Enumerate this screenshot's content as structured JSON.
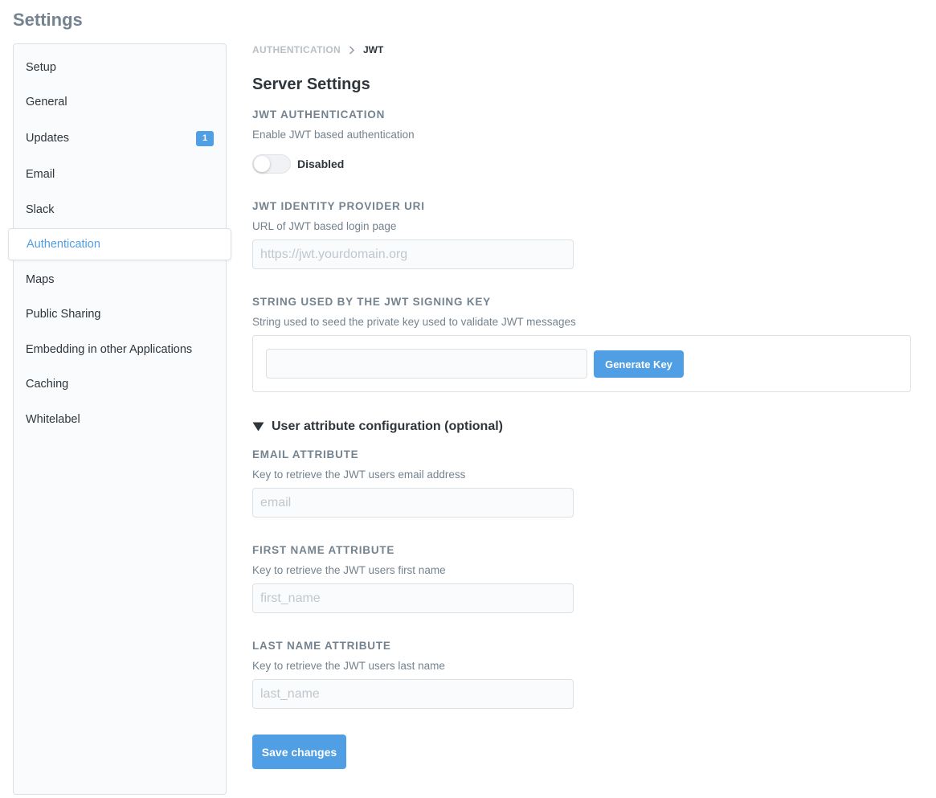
{
  "page": {
    "title": "Settings"
  },
  "sidebar": {
    "items": [
      {
        "label": "Setup"
      },
      {
        "label": "General"
      },
      {
        "label": "Updates",
        "badge": "1"
      },
      {
        "label": "Email"
      },
      {
        "label": "Slack"
      },
      {
        "label": "Authentication",
        "active": true
      },
      {
        "label": "Maps"
      },
      {
        "label": "Public Sharing"
      },
      {
        "label": "Embedding in other Applications"
      },
      {
        "label": "Caching"
      },
      {
        "label": "Whitelabel"
      }
    ]
  },
  "breadcrumb": {
    "parent": "AUTHENTICATION",
    "current": "JWT"
  },
  "main": {
    "section_title": "Server Settings",
    "jwt_auth": {
      "label": "JWT AUTHENTICATION",
      "description": "Enable JWT based authentication",
      "toggle_state": "Disabled",
      "enabled": false
    },
    "identity_provider": {
      "label": "JWT IDENTITY PROVIDER URI",
      "description": "URL of JWT based login page",
      "placeholder": "https://jwt.yourdomain.org",
      "value": ""
    },
    "signing_key": {
      "label": "STRING USED BY THE JWT SIGNING KEY",
      "description": "String used to seed the private key used to validate JWT messages",
      "value": "",
      "generate_label": "Generate Key"
    },
    "user_attributes": {
      "title": "User attribute configuration (optional)",
      "expanded": true,
      "email": {
        "label": "EMAIL ATTRIBUTE",
        "description": "Key to retrieve the JWT users email address",
        "placeholder": "email"
      },
      "first_name": {
        "label": "FIRST NAME ATTRIBUTE",
        "description": "Key to retrieve the JWT users first name",
        "placeholder": "first_name"
      },
      "last_name": {
        "label": "LAST NAME ATTRIBUTE",
        "description": "Key to retrieve the JWT users last name",
        "placeholder": "last_name"
      }
    },
    "save_label": "Save changes"
  },
  "icons": {
    "breadcrumb_separator": "chevron-right-icon",
    "collapse": "triangle-down-icon"
  },
  "colors": {
    "accent": "#509ee3",
    "text_dark": "#2e353b",
    "text_muted": "#74838f",
    "border": "#dce1e4",
    "input_bg": "#f9fbfc"
  }
}
